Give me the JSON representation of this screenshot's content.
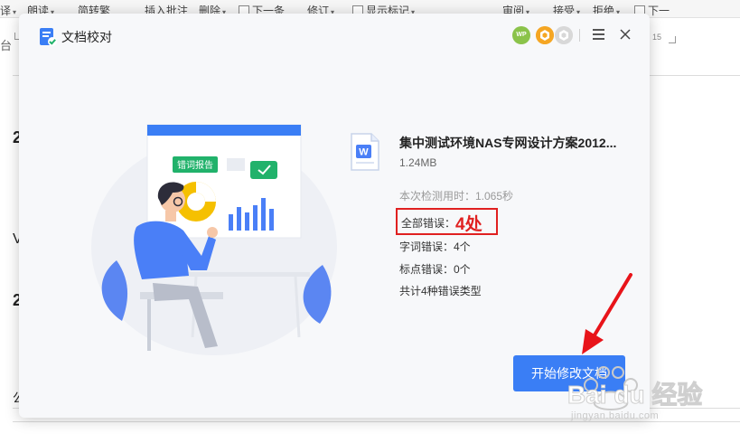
{
  "background": {
    "toolbar": {
      "items": [
        "译",
        "朗读",
        "简转繁",
        "插入批注",
        "删除",
        "下一条",
        "修订",
        "显示标记",
        "审阅",
        "接受",
        "拒绝",
        "下一"
      ],
      "page_num": "15"
    },
    "doc_fragments": [
      "台",
      "2",
      "V",
      "2",
      "公"
    ]
  },
  "dialog": {
    "title": "文档校对",
    "header_badges": [
      "WP"
    ],
    "file": {
      "name": "集中测试环境NAS专网设计方案2012...",
      "size": "1.24MB",
      "icon_letter": "W"
    },
    "check_time": "本次检测用时：1.065秒",
    "total_errors": {
      "label": "全部错误：",
      "value": "4处"
    },
    "word_errors": "字词错误：4个",
    "punct_errors": "标点错误：0个",
    "error_types": "共计4种错误类型",
    "start_button": "开始修改文档",
    "illustration": {
      "tag_label": "错词报告"
    }
  },
  "watermark": {
    "brand": "Bai du 经验",
    "url": "jingyan.baidu.com"
  },
  "colors": {
    "accent": "#3a7ef5",
    "error_red": "#e02020",
    "green": "#21b26b",
    "figure_blue": "#4a7ff7"
  }
}
